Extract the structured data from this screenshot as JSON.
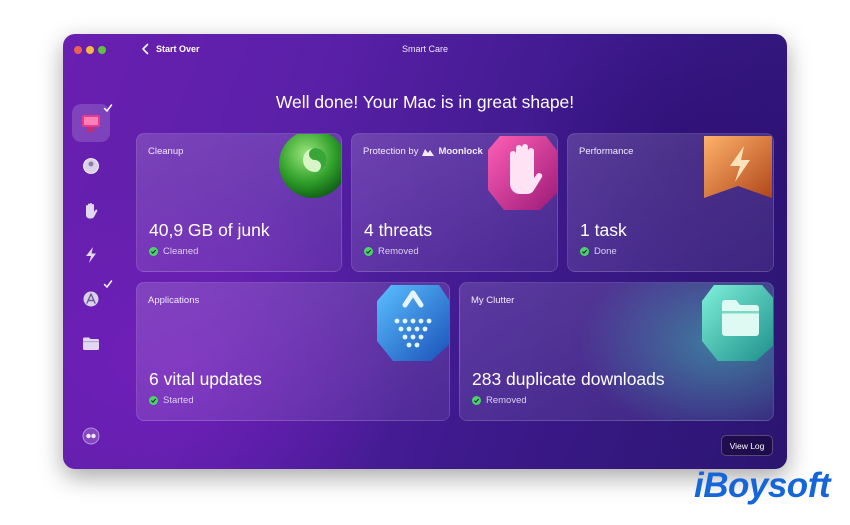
{
  "window": {
    "title": "Smart Care",
    "back_label": "Start Over"
  },
  "sidebar": {
    "items": [
      {
        "icon": "monitor-icon",
        "active": true,
        "checked": true
      },
      {
        "icon": "cleanup-disc-icon",
        "active": false,
        "checked": false
      },
      {
        "icon": "hand-icon",
        "active": false,
        "checked": false
      },
      {
        "icon": "lightning-icon",
        "active": false,
        "checked": false
      },
      {
        "icon": "applications-icon",
        "active": false,
        "checked": true
      },
      {
        "icon": "folder-icon",
        "active": false,
        "checked": false
      }
    ],
    "footer_icon": "assistant-icon"
  },
  "headline": "Well done! Your Mac is in great shape!",
  "cards": {
    "cleanup": {
      "title": "Cleanup",
      "value": "40,9 GB of junk",
      "status": "Cleaned"
    },
    "protection": {
      "title_prefix": "Protection by",
      "brand": "Moonlock",
      "value": "4 threats",
      "status": "Removed"
    },
    "performance": {
      "title": "Performance",
      "value": "1 task",
      "status": "Done"
    },
    "applications": {
      "title": "Applications",
      "value": "6 vital updates",
      "status": "Started"
    },
    "clutter": {
      "title": "My Clutter",
      "value": "283 duplicate downloads",
      "status": "Removed"
    }
  },
  "view_log_label": "View Log",
  "watermark": "iBoysoft",
  "colors": {
    "status_dot": "#4cd46a",
    "watermark": "#1566d8"
  }
}
